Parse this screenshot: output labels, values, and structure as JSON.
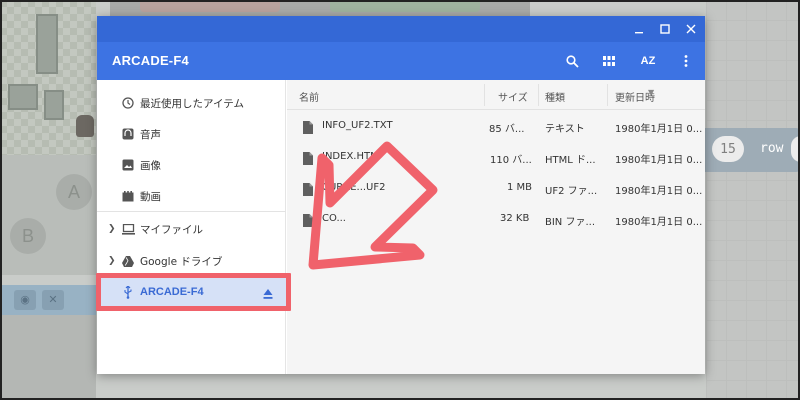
{
  "dialog": {
    "title": "ARCADE-F4",
    "window_controls": [
      "minimize-icon",
      "maximize-icon",
      "close-icon"
    ],
    "header_actions": [
      "search-icon",
      "grid-view-icon",
      "sort-az-icon",
      "more-vert-icon"
    ],
    "sort_icon_label": "AZ"
  },
  "sidebar": {
    "items": [
      {
        "label": "最近使用したアイテム",
        "icon": "clock-icon"
      },
      {
        "label": "音声",
        "icon": "audio-icon"
      },
      {
        "label": "画像",
        "icon": "image-icon"
      },
      {
        "label": "動画",
        "icon": "video-icon"
      },
      {
        "label": "マイファイル",
        "icon": "laptop-icon"
      },
      {
        "label": "Google ドライブ",
        "icon": "drive-icon"
      },
      {
        "label": "ARCADE-F4",
        "icon": "usb-icon",
        "selected": true
      }
    ]
  },
  "columns": {
    "name": "名前",
    "size": "サイズ",
    "type": "種類",
    "modified": "更新日時"
  },
  "files": [
    {
      "name": "INFO_UF2.TXT",
      "size": "85 バ...",
      "type": "テキスト",
      "modified": "1980年1月1日 0..."
    },
    {
      "name": "INDEX.HTM",
      "size": "110 バ...",
      "type": "HTML ド...",
      "modified": "1980年1月1日 0..."
    },
    {
      "name": "CURRE...UF2",
      "size": "1 MB",
      "type": "UF2 ファ...",
      "modified": "1980年1月1日 0..."
    },
    {
      "name": "CO...",
      "size": "32 KB",
      "type": "BIN ファ...",
      "modified": "1980年1月1日 0..."
    }
  ],
  "background": {
    "button_a": "A",
    "button_b": "B",
    "block_number": "15",
    "block_word": "row"
  },
  "colors": {
    "titlebar": "#3468d6",
    "header": "#3d73e3",
    "selected_bg": "#d6e1f7",
    "selected_text": "#3a6ad4",
    "annotation": "#f0626b"
  }
}
